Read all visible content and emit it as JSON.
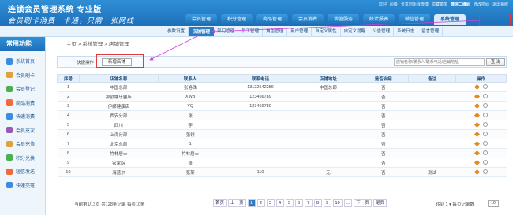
{
  "header": {
    "title": "连锁会员管理系统 专业版",
    "slogan": "会员刷卡消费一卡通，只需一张网线",
    "toplinks": [
      "欢迎",
      "超级",
      "分享到新浪微博",
      "隐藏菜单",
      "微信二维码",
      "修改密码",
      "退出系统"
    ],
    "nav": [
      "会员管理",
      "积分管理",
      "商品管理",
      "会员消费",
      "增值服务",
      "统计报表",
      "微信管理",
      "系统管理"
    ]
  },
  "subnav": [
    "参数设置",
    "店铺管理",
    "部门管理",
    "员工管理",
    "角色管理",
    "用户管理",
    "自定义属性",
    "自定义提醒",
    "公告管理",
    "系统日志",
    "留言管理"
  ],
  "sidebar": {
    "title": "常用功能",
    "items": [
      "系统首页",
      "会员刷卡",
      "会员登记",
      "商品消费",
      "快速消费",
      "会员充次",
      "会员充值",
      "积分兑换",
      "短信发送",
      "快速交班"
    ],
    "icon_colors": [
      "#3b8de0",
      "#e0a23b",
      "#4caf50",
      "#f06a3b",
      "#3b8de0",
      "#9b59b6",
      "#e0a23b",
      "#4caf50",
      "#f06a3b",
      "#3b8de0"
    ]
  },
  "breadcrumb": [
    "主页",
    "系统管理",
    "店铺管理"
  ],
  "toolbar": {
    "label": "快捷操作",
    "add_button": "新增店铺",
    "search_placeholder": "店铺名称/联系人/联系电话/店铺地址",
    "query_button": "查 询"
  },
  "table": {
    "columns": [
      "序号",
      "店铺名称",
      "联系人",
      "联系电话",
      "店铺地址",
      "是否启用",
      "备注",
      "操作"
    ],
    "rows": [
      [
        "1",
        "中国总部",
        "张洛珠",
        "13122542256",
        "中国总部",
        "否",
        ""
      ],
      [
        "2",
        "那欧娜乐器店",
        "XWB",
        "123456789",
        "",
        "否",
        ""
      ],
      [
        "3",
        "伊娜健康店",
        "YQ",
        "123456780",
        "",
        "否",
        ""
      ],
      [
        "4",
        "西安分部",
        "张",
        "",
        "",
        "否",
        ""
      ],
      [
        "5",
        "四川",
        "李",
        "",
        "",
        "否",
        ""
      ],
      [
        "6",
        "上海分部",
        "张领",
        "",
        "",
        "否",
        ""
      ],
      [
        "7",
        "北京总部",
        "1",
        "",
        "",
        "否",
        ""
      ],
      [
        "8",
        "竹林居士",
        "竹林居士",
        "",
        "",
        "否",
        ""
      ],
      [
        "9",
        "农家院",
        "张",
        "",
        "",
        "否",
        ""
      ],
      [
        "10",
        "海蓝尔",
        "张某",
        "110",
        "无",
        "否",
        "测试"
      ]
    ]
  },
  "pager": {
    "info": "当前第1/13页 共128条记录 每页10条",
    "buttons": [
      "首页",
      "上一页",
      "1",
      "2",
      "3",
      "4",
      "5",
      "6",
      "7",
      "8",
      "9",
      "10",
      "...",
      "下一页",
      "尾页"
    ],
    "current": "1",
    "goto_text": "转到 1 ▾ 每页记录数",
    "page_size": "10"
  },
  "colors": {
    "header_blue": "#1d6fb9",
    "highlight_red": "#e03b3b",
    "arrow_magenta": "#d63be0"
  }
}
